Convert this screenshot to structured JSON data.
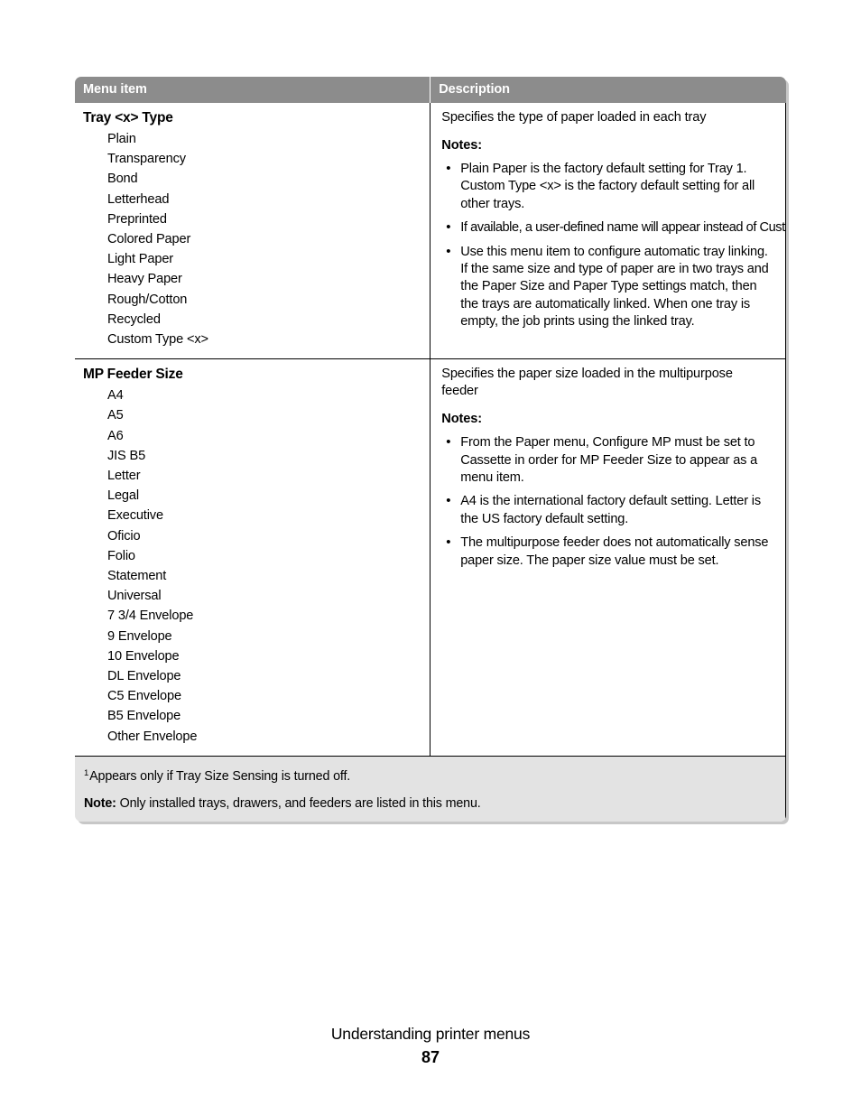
{
  "table": {
    "headers": {
      "menu_item": "Menu item",
      "description": "Description"
    },
    "rows": [
      {
        "title": "Tray <x> Type",
        "options": [
          "Plain",
          "Transparency",
          "Bond",
          "Letterhead",
          "Preprinted",
          "Colored Paper",
          "Light Paper",
          "Heavy Paper",
          "Rough/Cotton",
          "Recycled",
          "Custom Type <x>"
        ],
        "lead": "Specifies the type of paper loaded in each tray",
        "notes_label": "Notes:",
        "notes": [
          "Plain Paper is the factory default setting for Tray 1. Custom Type <x> is the factory default setting for all other trays.",
          "If available, a user-defined name will appear instead of Custom Type <x>.",
          "Use this menu item to configure automatic tray linking. If the same size and type of paper are in two trays and the Paper Size and Paper Type settings match, then the trays are automatically linked. When one tray is empty, the job prints using the linked tray."
        ]
      },
      {
        "title": "MP Feeder Size",
        "options": [
          "A4",
          "A5",
          "A6",
          "JIS B5",
          "Letter",
          "Legal",
          "Executive",
          "Oficio",
          "Folio",
          "Statement",
          "Universal",
          "7 3/4 Envelope",
          "9 Envelope",
          "10 Envelope",
          "DL Envelope",
          "C5 Envelope",
          "B5 Envelope",
          "Other Envelope"
        ],
        "lead": "Specifies the paper size loaded in the multipurpose feeder",
        "notes_label": "Notes:",
        "notes": [
          "From the Paper menu, Configure MP must be set to Cassette in order for MP Feeder Size to appear as a menu item.",
          "A4 is the international factory default setting. Letter is the US factory default setting.",
          "The multipurpose feeder does not automatically sense paper size. The paper size value must be set."
        ]
      }
    ],
    "footnotes": {
      "marker": "1",
      "footnote_text": "Appears only if Tray Size Sensing is turned off.",
      "note_label": "Note:",
      "note_text": "Only installed trays, drawers, and feeders are listed in this menu."
    }
  },
  "page_footer": {
    "title": "Understanding printer menus",
    "page_number": "87"
  },
  "colors": {
    "header_bg": "#8c8c8c",
    "header_text": "#ffffff",
    "footnote_bg": "#e3e3e3",
    "border": "#000000",
    "page_bg": "#ffffff"
  }
}
